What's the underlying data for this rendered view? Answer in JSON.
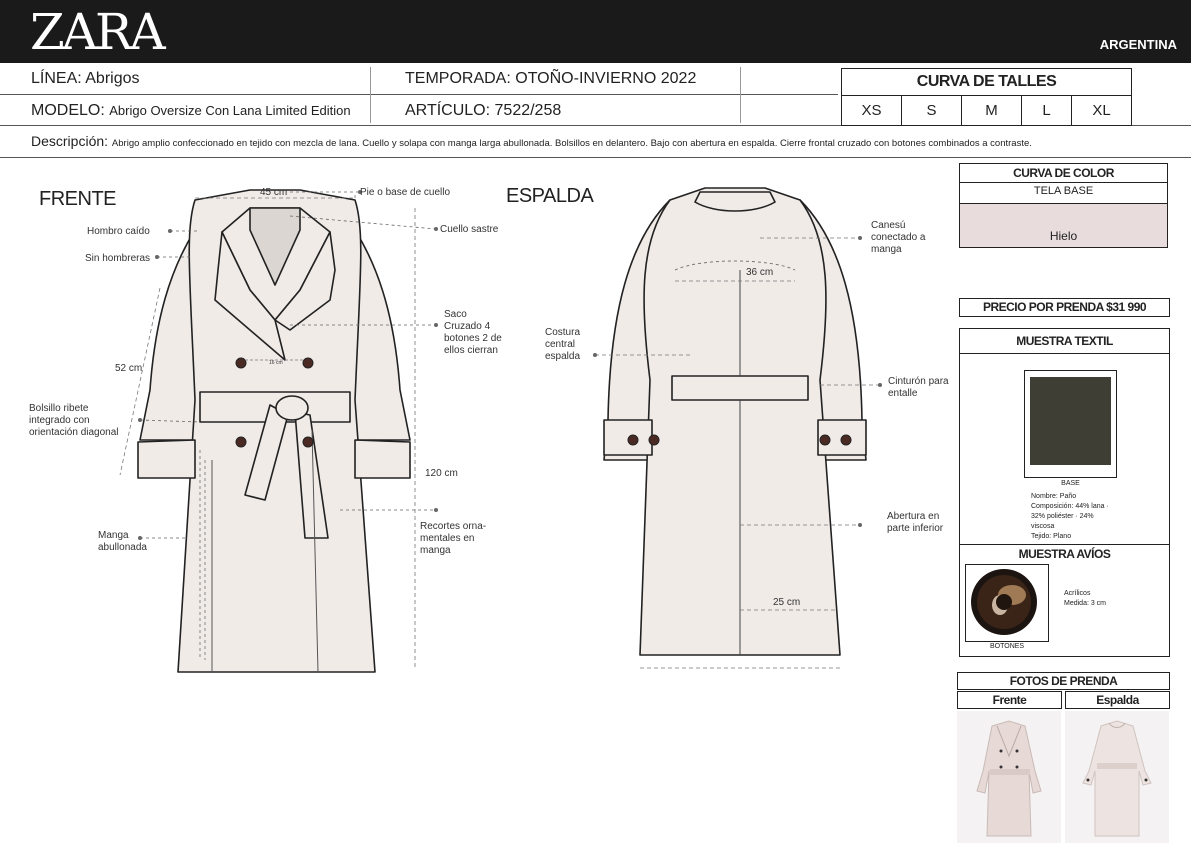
{
  "brand": "ZARA",
  "country": "ARGENTINA",
  "header": {
    "linea_label": "LÍNEA:",
    "linea_value": "Abrigos",
    "temporada_label": "TEMPORADA:",
    "temporada_value": "OTOÑO-INVIERNO 2022",
    "modelo_label": "MODELO:",
    "modelo_value": "Abrigo Oversize Con Lana Limited Edition",
    "articulo_label": "ARTÍCULO:",
    "articulo_value": "7522/258"
  },
  "sizes": {
    "title": "CURVA DE TALLES",
    "items": [
      "XS",
      "S",
      "M",
      "L",
      "XL"
    ]
  },
  "description": {
    "label": "Descripción:",
    "text": "Abrigo amplio confeccionado en tejido con mezcla de lana. Cuello y solapa con manga larga abullonada. Bolsillos en delantero. Bajo con abertura en espalda. Cierre frontal cruzado con botones combinados a contraste."
  },
  "front": {
    "title": "FRENTE",
    "labels": {
      "hombro": "Hombro caído",
      "hombreras": "Sin hombreras",
      "bolsillo": "Bolsillo ribete integrado con orientación diagonal",
      "manga": "Manga abullonada",
      "pie_cuello": "Pie o base de cuello",
      "cuello": "Cuello sastre",
      "saco": "Saco Cruzado 4 botones 2 de ellos cierran",
      "recortes": "Recortes orna- mentales en manga"
    },
    "measures": {
      "ancho_cuello": "45 cm",
      "manga_largo": "52 cm",
      "botones": "16 cm",
      "largo_total": "120 cm"
    }
  },
  "back": {
    "title": "ESPALDA",
    "labels": {
      "costura": "Costura central espalda",
      "canesu": "Canesú conectado a manga",
      "cinturon": "Cinturón para entalle",
      "abertura": "Abertura en parte inferior"
    },
    "measures": {
      "espalda": "36 cm",
      "abertura": "25 cm"
    }
  },
  "color": {
    "title": "CURVA DE COLOR",
    "fabric": "TELA BASE",
    "name": "Hielo",
    "swatch": "#e8dcdc"
  },
  "price": "PRECIO POR PRENDA $31 990",
  "textile": {
    "title": "MUESTRA TEXTIL",
    "caption": "BASE",
    "swatch": "#3e3e34",
    "details": [
      "Nombre: Paño",
      "Composición: 44% lana ·",
      "32% poliéster · 24%",
      "viscosa",
      "Tejido: Plano"
    ]
  },
  "trims": {
    "title": "MUESTRA AVÍOS",
    "caption": "BOTONES",
    "details": [
      "Acrílicos",
      "Medida: 3 cm"
    ]
  },
  "photos": {
    "title": "FOTOS DE PRENDA",
    "front": "Frente",
    "back": "Espalda"
  }
}
